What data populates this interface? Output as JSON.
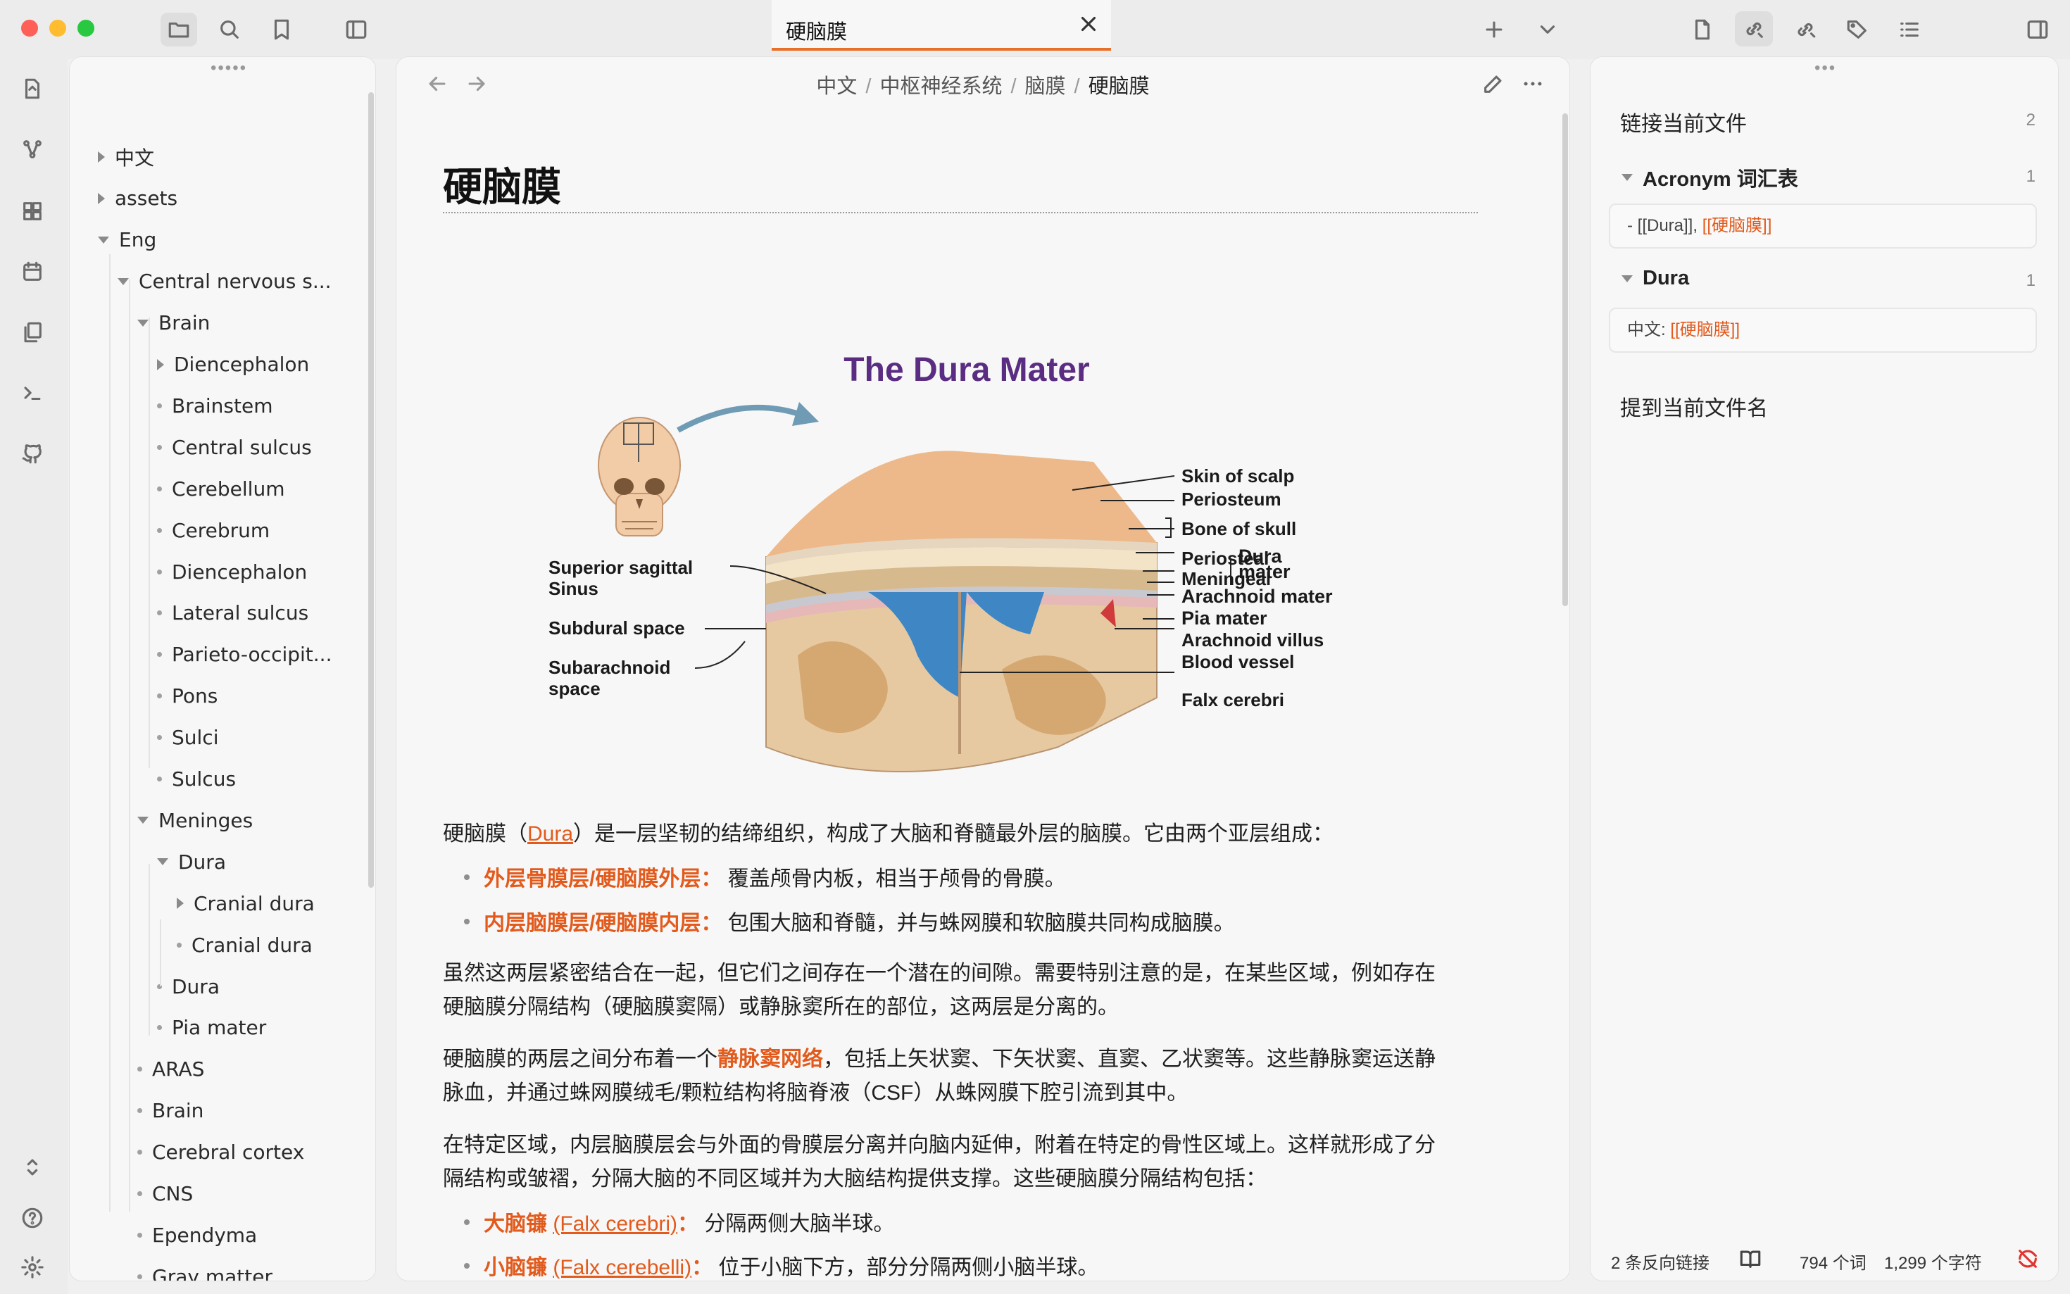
{
  "window": {
    "title": "硬脑膜"
  },
  "titlebar": {
    "left_icons": [
      "folder-icon",
      "search-icon",
      "bookmark-icon",
      "sidebar-toggle-icon"
    ],
    "right_icons": [
      "file-icon",
      "backlinks-icon",
      "outgoing-links-icon",
      "tags-icon",
      "outline-icon",
      "right-sidebar-toggle-icon"
    ]
  },
  "ribbon": {
    "icons": [
      "open-quick-switcher-icon",
      "graph-view-icon",
      "canvas-icon",
      "daily-note-icon",
      "templates-icon",
      "command-palette-icon",
      "publish-icon"
    ],
    "bottom_icons": [
      "vault-switcher-icon",
      "help-icon",
      "settings-icon"
    ]
  },
  "tree": [
    {
      "label": "中文",
      "level": 0,
      "kind": "collapsed"
    },
    {
      "label": "assets",
      "level": 0,
      "kind": "collapsed"
    },
    {
      "label": "Eng",
      "level": 0,
      "kind": "expanded"
    },
    {
      "label": "Central nervous s...",
      "level": 1,
      "kind": "expanded"
    },
    {
      "label": "Brain",
      "level": 2,
      "kind": "expanded"
    },
    {
      "label": "Diencephalon",
      "level": 3,
      "kind": "collapsed"
    },
    {
      "label": "Brainstem",
      "level": 3,
      "kind": "file"
    },
    {
      "label": "Central sulcus",
      "level": 3,
      "kind": "file"
    },
    {
      "label": "Cerebellum",
      "level": 3,
      "kind": "file"
    },
    {
      "label": "Cerebrum",
      "level": 3,
      "kind": "file"
    },
    {
      "label": "Diencephalon",
      "level": 3,
      "kind": "file"
    },
    {
      "label": "Lateral sulcus",
      "level": 3,
      "kind": "file"
    },
    {
      "label": "Parieto-occipit...",
      "level": 3,
      "kind": "file"
    },
    {
      "label": "Pons",
      "level": 3,
      "kind": "file"
    },
    {
      "label": "Sulci",
      "level": 3,
      "kind": "file"
    },
    {
      "label": "Sulcus",
      "level": 3,
      "kind": "file"
    },
    {
      "label": "Meninges",
      "level": 2,
      "kind": "expanded"
    },
    {
      "label": "Dura",
      "level": 3,
      "kind": "expanded"
    },
    {
      "label": "Cranial dura",
      "level": 4,
      "kind": "collapsed"
    },
    {
      "label": "Cranial dura",
      "level": 4,
      "kind": "file"
    },
    {
      "label": "Dura",
      "level": 3,
      "kind": "file"
    },
    {
      "label": "Pia mater",
      "level": 3,
      "kind": "file"
    },
    {
      "label": "ARAS",
      "level": 2,
      "kind": "file"
    },
    {
      "label": "Brain",
      "level": 2,
      "kind": "file"
    },
    {
      "label": "Cerebral cortex",
      "level": 2,
      "kind": "file"
    },
    {
      "label": "CNS",
      "level": 2,
      "kind": "file"
    },
    {
      "label": "Ependyma",
      "level": 2,
      "kind": "file"
    },
    {
      "label": "Gray matter",
      "level": 2,
      "kind": "file"
    }
  ],
  "breadcrumb": [
    "中文",
    "中枢神经系统",
    "脑膜",
    "硬脑膜"
  ],
  "doc": {
    "title": "硬脑膜",
    "figure": {
      "title": "The Dura Mater",
      "labels_right": [
        "Skin of scalp",
        "Periosteum",
        "Bone of skull",
        "Periosteal",
        "Meningeal",
        "Arachnoid mater",
        "Pia mater",
        "Arachnoid villus",
        "Blood vessel",
        "Falx cerebri"
      ],
      "dura_label_1": "Dura",
      "dura_label_2": "mater",
      "labels_left": [
        "Superior sagittal",
        "Sinus",
        "Subdural space",
        "Subarachnoid",
        "space"
      ]
    },
    "p1_a": "硬脑膜（",
    "p1_link": "Dura",
    "p1_b": "）是一层坚韧的结缔组织，构成了大脑和脊髓最外层的脑膜。它由两个亚层组成：",
    "li1_term": "外层骨膜层/硬脑膜外层：",
    "li1_text": " 覆盖颅骨内板，相当于颅骨的骨膜。",
    "li2_term": "内层脑膜层/硬脑膜内层：",
    "li2_text": " 包围大脑和脊髓，并与蛛网膜和软脑膜共同构成脑膜。",
    "p2_l1": "虽然这两层紧密结合在一起，但它们之间存在一个潜在的间隙。需要特别注意的是，在某些区域，例如存在",
    "p2_l2": "硬脑膜分隔结构（硬脑膜窦隔）或静脉窦所在的部位，这两层是分离的。",
    "p3_a": "硬脑膜的两层之间分布着一个",
    "p3_term": "静脉窦网络",
    "p3_b": "，包括上矢状窦、下矢状窦、直窦、乙状窦等。这些静脉窦运送静",
    "p3_l2": "脉血，并通过蛛网膜绒毛/颗粒结构将脑脊液（CSF）从蛛网膜下腔引流到其中。",
    "p4_l1": "在特定区域，内层脑膜层会与外面的骨膜层分离并向脑内延伸，附着在特定的骨性区域上。这样就形成了分",
    "p4_l2": "隔结构或皱褶，分隔大脑的不同区域并为大脑结构提供支撑。这些硬脑膜分隔结构包括：",
    "li3_term": "大脑镰",
    "li3_link": "(Falx cerebri)",
    "li3_colon": "：",
    "li3_text": " 分隔两侧大脑半球。",
    "li4_term": "小脑镰",
    "li4_link": "(Falx cerebelli)",
    "li4_colon": "：",
    "li4_text": " 位于小脑下方，部分分隔两侧小脑半球。"
  },
  "backlinks": {
    "header": "链接当前文件",
    "count": "2",
    "groups": [
      {
        "name": "Acronym 词汇表",
        "count": "1",
        "snippet_prefix": "- [[Dura]], ",
        "snippet_link": "[[硬脑膜]]"
      },
      {
        "name": "Dura",
        "count": "1",
        "snippet_prefix": "中文: ",
        "snippet_link": "[[硬脑膜]]"
      }
    ],
    "unlinked_header": "提到当前文件名"
  },
  "statusbar": {
    "backlinks": "2 条反向链接",
    "words": "794 个词",
    "chars": "1,299 个字符"
  },
  "colors": {
    "accent": "#e25a1c",
    "tab_underline": "#e8702a",
    "close_red": "#fe5f57",
    "minimize_yellow": "#febc2e",
    "maximize_green": "#28c840"
  }
}
